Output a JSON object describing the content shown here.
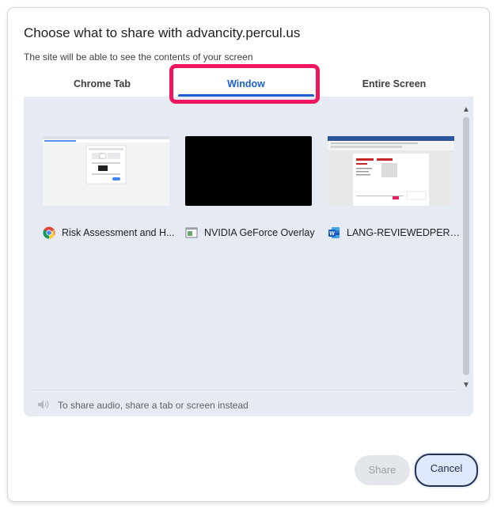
{
  "dialog": {
    "title": "Choose what to share with advancity.percul.us",
    "subtitle": "The site will be able to see the contents of your screen"
  },
  "tabs": [
    {
      "label": "Chrome Tab",
      "selected": false
    },
    {
      "label": "Window",
      "selected": true
    },
    {
      "label": "Entire Screen",
      "selected": false
    }
  ],
  "windows": [
    {
      "label": "Risk Assessment and H...",
      "icon": "chrome-icon"
    },
    {
      "label": "NVIDIA GeForce Overlay",
      "icon": "app-window-icon"
    },
    {
      "label": "LANG-REVIEWEDPERCU...",
      "icon": "word-icon"
    }
  ],
  "audio_note": "To share audio, share a tab or screen instead",
  "buttons": {
    "share": "Share",
    "cancel": "Cancel"
  },
  "colors": {
    "accent": "#1a5fd4",
    "highlight": "#f0155d",
    "panel_bg": "#e6eaf2"
  }
}
